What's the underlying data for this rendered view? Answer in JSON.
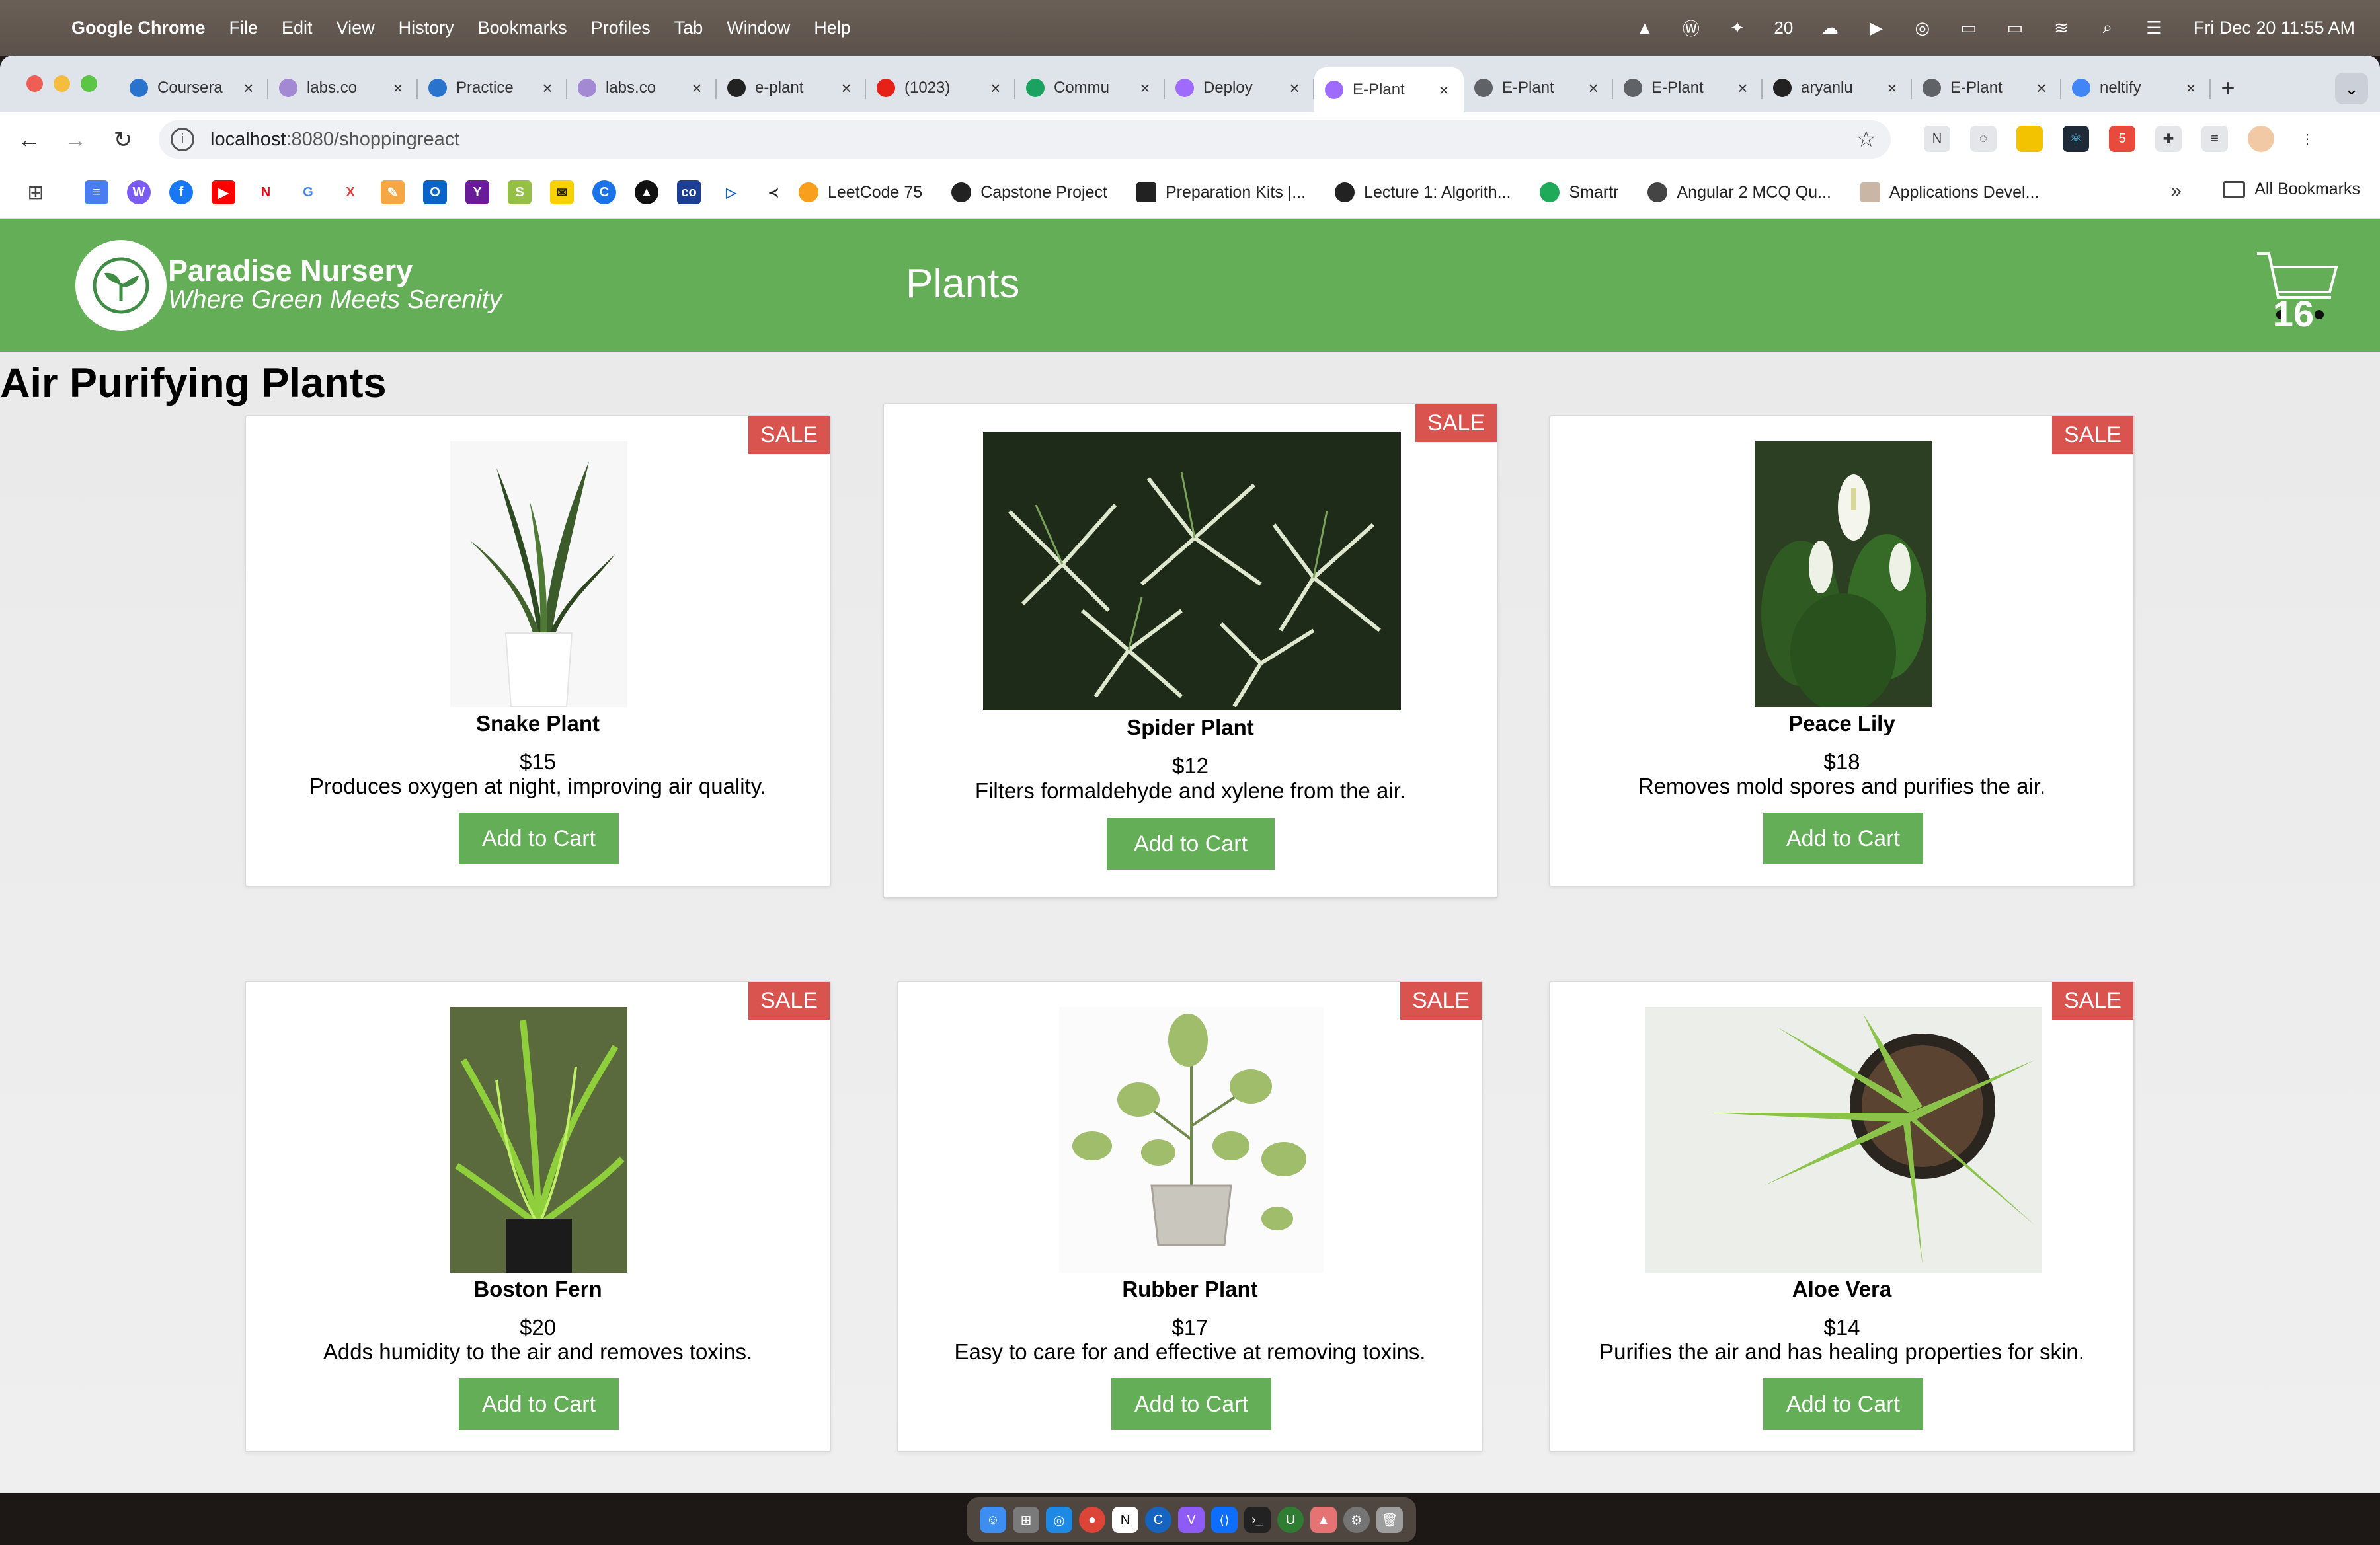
{
  "menubar": {
    "app_name": "Google Chrome",
    "items": [
      "File",
      "Edit",
      "View",
      "History",
      "Bookmarks",
      "Profiles",
      "Tab",
      "Window",
      "Help"
    ],
    "clock": "Fri Dec 20  11:55 AM",
    "calendar_badge": "20"
  },
  "tabs": [
    {
      "title": "Coursera",
      "favicon": "coursera-icon",
      "color": "#2a73cc"
    },
    {
      "title": "labs.co",
      "favicon": "labs-icon",
      "color": "#a389d4"
    },
    {
      "title": "Practice",
      "favicon": "coursera-icon",
      "color": "#2a73cc"
    },
    {
      "title": "labs.co",
      "favicon": "labs-icon",
      "color": "#a389d4"
    },
    {
      "title": "e-plant",
      "favicon": "github-icon",
      "color": "#222222"
    },
    {
      "title": "(1023)",
      "favicon": "youtube-icon",
      "color": "#e62117"
    },
    {
      "title": "Commu",
      "favicon": "sheet-icon",
      "color": "#1aa260"
    },
    {
      "title": "Deploy",
      "favicon": "vite-icon",
      "color": "#9f6bff"
    },
    {
      "title": "E-Plant",
      "favicon": "vite-icon",
      "color": "#9f6bff",
      "active": true
    },
    {
      "title": "E-Plant",
      "favicon": "globe-icon",
      "color": "#5f6368"
    },
    {
      "title": "E-Plant",
      "favicon": "globe-icon",
      "color": "#5f6368"
    },
    {
      "title": "aryanlu",
      "favicon": "github-icon",
      "color": "#222222"
    },
    {
      "title": "E-Plant",
      "favicon": "globe-icon",
      "color": "#5f6368"
    },
    {
      "title": "neltify",
      "favicon": "google-icon",
      "color": "#4285f4"
    }
  ],
  "address_bar": {
    "host": "localhost",
    "path": ":8080/shoppingreact"
  },
  "bookmarks": {
    "items": [
      {
        "label": "LeetCode 75"
      },
      {
        "label": "Capstone Project"
      },
      {
        "label": "Preparation Kits |..."
      },
      {
        "label": "Lecture 1: Algorith..."
      },
      {
        "label": "Smartr"
      },
      {
        "label": "Angular 2 MCQ Qu..."
      },
      {
        "label": "Applications Devel..."
      }
    ],
    "all_bookmarks": "All Bookmarks"
  },
  "site": {
    "brand_name": "Paradise Nursery",
    "tagline": "Where Green Meets Serenity",
    "nav_title": "Plants",
    "cart_count": "16",
    "section_title": "Air Purifying Plants",
    "sale_label": "SALE",
    "add_to_cart_label": "Add to Cart",
    "plants": [
      {
        "name": "Snake Plant",
        "price": "$15",
        "description": "Produces oxygen at night, improving air quality."
      },
      {
        "name": "Spider Plant",
        "price": "$12",
        "description": "Filters formaldehyde and xylene from the air."
      },
      {
        "name": "Peace Lily",
        "price": "$18",
        "description": "Removes mold spores and purifies the air."
      },
      {
        "name": "Boston Fern",
        "price": "$20",
        "description": "Adds humidity to the air and removes toxins."
      },
      {
        "name": "Rubber Plant",
        "price": "$17",
        "description": "Easy to care for and effective at removing toxins."
      },
      {
        "name": "Aloe Vera",
        "price": "$14",
        "description": "Purifies the air and has healing properties for skin."
      }
    ]
  },
  "colors": {
    "header_green": "#65ae58",
    "sale_red": "#d9534f",
    "button_green": "#65ae58"
  }
}
